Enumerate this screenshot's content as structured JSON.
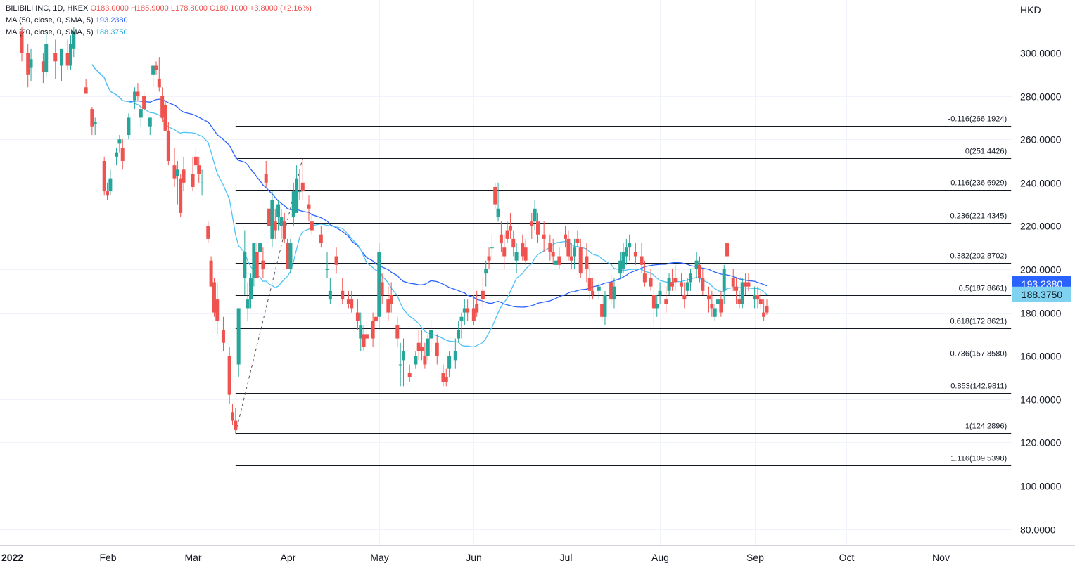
{
  "header": {
    "symbol": "BILIBILI INC, 1D, HKEX",
    "ohlc": {
      "o_label": "O",
      "o": "183.0000",
      "h_label": "H",
      "h": "185.9000",
      "l_label": "L",
      "l": "178.8000",
      "c_label": "C",
      "c": "180.1000",
      "change": "+3.8000 (+2.16%)"
    },
    "ma50_text": "MA (50, close, 0, SMA, 5)",
    "ma50_value": "193.2380",
    "ma20_text": "MA (20, close, 0, SMA, 5)",
    "ma20_value": "188.3750"
  },
  "colors": {
    "up": "#26a69a",
    "down": "#ef5350",
    "ma50": "#2962ff",
    "ma20": "#4fc3f7",
    "ma20_badge": "#7fd3f0",
    "fib_line": "#131722",
    "grid": "#f0f3fa"
  },
  "chart_data": {
    "type": "candlestick",
    "currency": "HKD",
    "y_ticks": [
      "300.0000",
      "280.0000",
      "260.0000",
      "240.0000",
      "220.0000",
      "200.0000",
      "180.0000",
      "160.0000",
      "140.0000",
      "120.0000",
      "100.0000",
      "80.0000"
    ],
    "y_tick_values": [
      300,
      280,
      260,
      240,
      220,
      200,
      180,
      160,
      140,
      120,
      100,
      80
    ],
    "ylim": [
      71,
      320
    ],
    "x_labels": [
      {
        "label": "2022",
        "day": 0,
        "year": true
      },
      {
        "label": "Feb",
        "day": 31
      },
      {
        "label": "Mar",
        "day": 59
      },
      {
        "label": "Apr",
        "day": 90
      },
      {
        "label": "May",
        "day": 120
      },
      {
        "label": "Jun",
        "day": 151
      },
      {
        "label": "Jul",
        "day": 181
      },
      {
        "label": "Aug",
        "day": 212
      },
      {
        "label": "Sep",
        "day": 243
      },
      {
        "label": "Oct",
        "day": 273
      },
      {
        "label": "Nov",
        "day": 304
      }
    ],
    "x_range_days": [
      0,
      334
    ],
    "price_badges": [
      {
        "value": "193.2380",
        "price": 193.238,
        "series": "ma50"
      },
      {
        "value": "188.3750",
        "price": 188.375,
        "series": "ma20"
      }
    ],
    "fib_levels": [
      {
        "label": "-0.116(266.1924)",
        "price": 266.1924
      },
      {
        "label": "0(251.4426)",
        "price": 251.4426
      },
      {
        "label": "0.116(236.6929)",
        "price": 236.6929
      },
      {
        "label": "0.236(221.4345)",
        "price": 221.4345
      },
      {
        "label": "0.382(202.8702)",
        "price": 202.8702
      },
      {
        "label": "0.5(187.8661)",
        "price": 187.8661
      },
      {
        "label": "0.618(172.8621)",
        "price": 172.8621
      },
      {
        "label": "0.736(157.8580)",
        "price": 157.858
      },
      {
        "label": "0.853(142.9811)",
        "price": 142.9811
      },
      {
        "label": "1(124.2896)",
        "price": 124.2896
      },
      {
        "label": "1.116(109.5398)",
        "price": 109.5398
      }
    ],
    "fib_range_days": [
      73,
      327
    ],
    "fib_trend": {
      "from": {
        "day": 73,
        "price": 124.29
      },
      "to": {
        "day": 95,
        "price": 251.44
      }
    },
    "candles": [
      [
        3,
        310,
        312,
        296,
        300
      ],
      [
        5,
        300,
        304,
        284,
        290
      ],
      [
        6,
        293,
        302,
        287,
        297
      ],
      [
        10,
        296,
        300,
        286,
        291
      ],
      [
        11,
        291,
        309,
        289,
        304
      ],
      [
        14,
        300,
        306,
        288,
        296
      ],
      [
        16,
        294,
        300,
        287,
        302
      ],
      [
        18,
        300,
        306,
        292,
        294
      ],
      [
        19,
        294,
        308,
        292,
        304
      ],
      [
        20,
        302,
        312,
        298,
        310
      ],
      [
        24,
        284,
        288,
        281,
        281
      ],
      [
        26,
        274,
        275,
        262,
        266
      ],
      [
        27,
        267,
        270,
        262,
        268
      ],
      [
        30,
        250,
        252,
        234,
        236
      ],
      [
        31,
        236,
        240,
        232,
        234
      ],
      [
        32,
        236,
        246,
        234,
        242
      ],
      [
        34,
        252,
        256,
        248,
        254
      ],
      [
        35,
        258,
        262,
        254,
        260
      ],
      [
        36,
        256,
        260,
        246,
        250
      ],
      [
        38,
        262,
        272,
        260,
        270
      ],
      [
        40,
        278,
        284,
        274,
        282
      ],
      [
        41,
        282,
        286,
        278,
        280
      ],
      [
        42,
        270,
        276,
        266,
        274
      ],
      [
        43,
        280,
        282,
        272,
        274
      ],
      [
        45,
        266,
        270,
        262,
        270
      ],
      [
        46,
        290,
        294,
        284,
        294
      ],
      [
        47,
        294,
        296,
        290,
        292
      ],
      [
        48,
        288,
        298,
        282,
        284
      ],
      [
        49,
        280,
        284,
        268,
        270
      ],
      [
        50,
        276,
        278,
        264,
        264
      ],
      [
        51,
        264,
        268,
        248,
        250
      ],
      [
        53,
        248,
        256,
        238,
        242
      ],
      [
        54,
        243,
        250,
        230,
        246
      ],
      [
        55,
        242,
        244,
        224,
        226
      ],
      [
        56,
        246,
        252,
        236,
        240
      ],
      [
        59,
        244,
        252,
        236,
        238
      ],
      [
        60,
        252,
        256,
        246,
        248
      ],
      [
        61,
        248,
        252,
        240,
        244
      ],
      [
        62,
        240,
        246,
        234,
        240
      ],
      [
        64,
        220,
        222,
        212,
        214
      ],
      [
        65,
        204,
        206,
        192,
        192
      ],
      [
        66,
        194,
        196,
        178,
        180
      ],
      [
        67,
        186,
        194,
        170,
        176
      ],
      [
        69,
        172,
        178,
        162,
        166
      ],
      [
        71,
        160,
        164,
        138,
        142
      ],
      [
        72,
        134,
        138,
        128,
        130
      ],
      [
        73,
        130,
        136,
        124,
        126
      ],
      [
        74,
        156,
        182,
        150,
        182
      ],
      [
        76,
        196,
        218,
        188,
        208
      ],
      [
        77,
        182,
        194,
        176,
        186
      ],
      [
        78,
        186,
        198,
        182,
        196
      ],
      [
        79,
        196,
        212,
        192,
        212
      ],
      [
        80,
        208,
        212,
        196,
        196
      ],
      [
        81,
        208,
        214,
        204,
        212
      ],
      [
        82,
        204,
        210,
        196,
        200
      ],
      [
        83,
        244,
        250,
        238,
        240
      ],
      [
        84,
        228,
        232,
        216,
        220
      ],
      [
        85,
        214,
        236,
        210,
        232
      ],
      [
        86,
        222,
        228,
        214,
        218
      ],
      [
        87,
        224,
        232,
        218,
        230
      ],
      [
        88,
        220,
        228,
        214,
        224
      ],
      [
        89,
        222,
        226,
        212,
        214
      ],
      [
        90,
        212,
        214,
        202,
        200
      ],
      [
        91,
        200,
        214,
        198,
        212
      ],
      [
        92,
        224,
        240,
        220,
        236
      ],
      [
        93,
        226,
        248,
        226,
        242
      ],
      [
        94,
        236,
        246,
        232,
        236
      ],
      [
        95,
        240,
        251,
        232,
        236
      ],
      [
        97,
        230,
        234,
        222,
        228
      ],
      [
        98,
        222,
        226,
        216,
        218
      ],
      [
        101,
        216,
        220,
        210,
        212
      ],
      [
        103,
        200,
        208,
        196,
        200
      ],
      [
        104,
        186,
        196,
        184,
        190
      ],
      [
        106,
        206,
        210,
        198,
        202
      ],
      [
        108,
        190,
        196,
        184,
        186
      ],
      [
        110,
        186,
        190,
        182,
        184
      ],
      [
        111,
        186,
        190,
        180,
        182
      ],
      [
        113,
        180,
        186,
        172,
        176
      ],
      [
        114,
        168,
        180,
        162,
        174
      ],
      [
        115,
        170,
        174,
        162,
        164
      ],
      [
        116,
        170,
        176,
        164,
        168
      ],
      [
        118,
        176,
        180,
        164,
        168
      ],
      [
        119,
        178,
        182,
        172,
        176
      ],
      [
        120,
        178,
        212,
        172,
        208
      ],
      [
        121,
        194,
        198,
        184,
        188
      ],
      [
        123,
        186,
        192,
        176,
        180
      ],
      [
        124,
        188,
        194,
        180,
        184
      ],
      [
        126,
        174,
        178,
        164,
        168
      ],
      [
        127,
        156,
        166,
        146,
        156
      ],
      [
        128,
        158,
        168,
        146,
        162
      ],
      [
        130,
        152,
        156,
        148,
        150
      ],
      [
        132,
        156,
        162,
        154,
        160
      ],
      [
        133,
        166,
        172,
        158,
        162
      ],
      [
        134,
        164,
        172,
        158,
        162
      ],
      [
        135,
        160,
        166,
        154,
        156
      ],
      [
        136,
        160,
        170,
        158,
        168
      ],
      [
        137,
        168,
        176,
        162,
        172
      ],
      [
        139,
        166,
        170,
        156,
        160
      ],
      [
        141,
        152,
        156,
        146,
        148
      ],
      [
        142,
        150,
        154,
        146,
        148
      ],
      [
        143,
        154,
        162,
        150,
        160
      ],
      [
        145,
        158,
        168,
        154,
        162
      ],
      [
        146,
        168,
        176,
        166,
        172
      ],
      [
        147,
        176,
        180,
        168,
        178
      ],
      [
        148,
        180,
        186,
        174,
        182
      ],
      [
        149,
        182,
        186,
        176,
        180
      ],
      [
        151,
        182,
        188,
        174,
        176
      ],
      [
        152,
        184,
        190,
        178,
        180
      ],
      [
        154,
        190,
        196,
        182,
        186
      ],
      [
        155,
        198,
        204,
        192,
        200
      ],
      [
        156,
        206,
        210,
        200,
        204
      ],
      [
        157,
        210,
        216,
        204,
        210
      ],
      [
        158,
        238,
        240,
        228,
        230
      ],
      [
        159,
        224,
        240,
        222,
        228
      ],
      [
        160,
        216,
        222,
        208,
        212
      ],
      [
        161,
        210,
        216,
        200,
        206
      ],
      [
        162,
        218,
        222,
        212,
        214
      ],
      [
        163,
        220,
        226,
        214,
        218
      ],
      [
        164,
        214,
        218,
        206,
        210
      ],
      [
        165,
        204,
        212,
        198,
        208
      ],
      [
        167,
        212,
        216,
        204,
        206
      ],
      [
        168,
        210,
        214,
        202,
        204
      ],
      [
        170,
        222,
        226,
        214,
        220
      ],
      [
        171,
        222,
        232,
        218,
        228
      ],
      [
        172,
        222,
        226,
        212,
        216
      ],
      [
        174,
        216,
        222,
        208,
        214
      ],
      [
        176,
        212,
        216,
        204,
        208
      ],
      [
        177,
        208,
        214,
        202,
        206
      ],
      [
        178,
        202,
        208,
        198,
        204
      ],
      [
        179,
        206,
        210,
        200,
        202
      ],
      [
        181,
        216,
        220,
        210,
        214
      ],
      [
        182,
        214,
        218,
        204,
        206
      ],
      [
        183,
        206,
        212,
        200,
        204
      ],
      [
        184,
        206,
        214,
        200,
        210
      ],
      [
        185,
        214,
        218,
        210,
        212
      ],
      [
        186,
        210,
        214,
        196,
        198
      ],
      [
        188,
        206,
        212,
        194,
        200
      ],
      [
        189,
        196,
        202,
        186,
        190
      ],
      [
        190,
        190,
        196,
        186,
        188
      ],
      [
        192,
        190,
        194,
        186,
        192
      ],
      [
        193,
        184,
        190,
        176,
        178
      ],
      [
        194,
        178,
        190,
        174,
        188
      ],
      [
        196,
        194,
        198,
        184,
        186
      ],
      [
        197,
        186,
        196,
        182,
        192
      ],
      [
        199,
        198,
        208,
        196,
        204
      ],
      [
        200,
        200,
        212,
        198,
        208
      ],
      [
        201,
        206,
        214,
        202,
        210
      ],
      [
        202,
        210,
        216,
        204,
        212
      ],
      [
        204,
        208,
        212,
        202,
        206
      ],
      [
        206,
        206,
        212,
        198,
        202
      ],
      [
        207,
        198,
        204,
        192,
        194
      ],
      [
        209,
        196,
        200,
        190,
        192
      ],
      [
        210,
        188,
        192,
        174,
        182
      ],
      [
        211,
        182,
        188,
        178,
        184
      ],
      [
        212,
        188,
        194,
        184,
        190
      ],
      [
        214,
        186,
        192,
        180,
        184
      ],
      [
        215,
        190,
        198,
        188,
        196
      ],
      [
        216,
        194,
        200,
        190,
        192
      ],
      [
        217,
        196,
        202,
        190,
        194
      ],
      [
        219,
        194,
        198,
        188,
        192
      ],
      [
        220,
        188,
        194,
        182,
        186
      ],
      [
        221,
        190,
        196,
        188,
        194
      ],
      [
        222,
        194,
        200,
        190,
        198
      ],
      [
        224,
        200,
        208,
        196,
        204
      ],
      [
        225,
        202,
        206,
        194,
        196
      ],
      [
        226,
        196,
        200,
        188,
        190
      ],
      [
        228,
        188,
        192,
        180,
        186
      ],
      [
        229,
        184,
        190,
        178,
        182
      ],
      [
        230,
        178,
        184,
        176,
        182
      ],
      [
        231,
        184,
        190,
        180,
        186
      ],
      [
        232,
        186,
        190,
        178,
        180
      ],
      [
        233,
        190,
        202,
        184,
        200
      ],
      [
        234,
        212,
        214,
        204,
        206
      ],
      [
        236,
        196,
        200,
        190,
        192
      ],
      [
        237,
        192,
        196,
        184,
        190
      ],
      [
        238,
        186,
        190,
        182,
        184
      ],
      [
        239,
        184,
        196,
        182,
        194
      ],
      [
        240,
        194,
        198,
        188,
        192
      ],
      [
        241,
        194,
        198,
        190,
        192
      ],
      [
        243,
        186,
        192,
        182,
        188
      ],
      [
        244,
        188,
        192,
        182,
        186
      ],
      [
        245,
        186,
        190,
        182,
        184
      ],
      [
        246,
        180,
        186,
        176,
        178
      ],
      [
        247,
        183,
        186,
        179,
        180
      ]
    ]
  }
}
